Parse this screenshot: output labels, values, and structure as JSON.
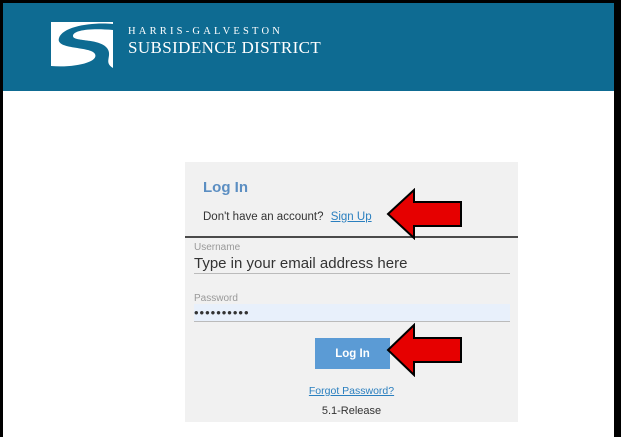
{
  "brand": {
    "line1": "HARRIS-GALVESTON",
    "line2": "SUBSIDENCE DISTRICT",
    "logo_icon": "s-wave-logo-icon"
  },
  "login": {
    "title": "Log In",
    "signup_prompt": "Don't have an account?",
    "signup_link": "Sign Up",
    "username_label": "Username",
    "username_value": "Type in your email address here",
    "password_label": "Password",
    "password_value": "••••••••••",
    "login_button": "Log In",
    "forgot_password": "Forgot Password?",
    "release": "5.1-Release"
  },
  "annotations": {
    "arrow_icon": "red-arrow-icon",
    "arrow_color": "#e60000"
  },
  "colors": {
    "banner": "#0e6b92",
    "accent": "#5b9bd5",
    "title": "#5b8ec2",
    "link": "#2a7fbf"
  }
}
